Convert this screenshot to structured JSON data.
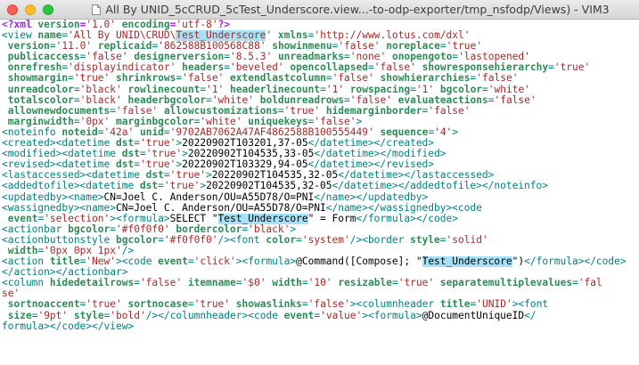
{
  "window": {
    "title": "All By UNID_5cCRUD_5cTest_Underscore.view...-to-odp-exporter/tmp_nsfodp/Views) - VIM3"
  },
  "colors": {
    "tag": "#008080",
    "attribute": "#2e8b57",
    "string": "#a52a2a",
    "processing_instruction": "#a020f0",
    "search_highlight": "#a6e2f7"
  },
  "icons": {
    "document": "document-icon"
  },
  "editor": {
    "lines": [
      [
        [
          "pi",
          "<?xml "
        ],
        [
          "attr",
          "version"
        ],
        [
          "pi",
          "="
        ],
        [
          "str",
          "'1.0'"
        ],
        [
          "pi",
          " "
        ],
        [
          "attr",
          "encoding"
        ],
        [
          "pi",
          "="
        ],
        [
          "str",
          "'utf-8'"
        ],
        [
          "pi",
          "?>"
        ]
      ],
      [
        [
          "tag",
          "<view "
        ],
        [
          "attr",
          "name"
        ],
        [
          "tag",
          "="
        ],
        [
          "str",
          "'All By UNID\\CRUD\\"
        ],
        [
          "hl",
          "Test_Underscore"
        ],
        [
          "str",
          "'"
        ],
        [
          "tag",
          " "
        ],
        [
          "attr",
          "xmlns"
        ],
        [
          "tag",
          "="
        ],
        [
          "str",
          "'http://www.lotus.com/dxl'"
        ]
      ],
      [
        [
          "tag",
          " "
        ],
        [
          "attr",
          "version"
        ],
        [
          "tag",
          "="
        ],
        [
          "str",
          "'11.0'"
        ],
        [
          "tag",
          " "
        ],
        [
          "attr",
          "replicaid"
        ],
        [
          "tag",
          "="
        ],
        [
          "str",
          "'862588B100568C88'"
        ],
        [
          "tag",
          " "
        ],
        [
          "attr",
          "showinmenu"
        ],
        [
          "tag",
          "="
        ],
        [
          "str",
          "'false'"
        ],
        [
          "tag",
          " "
        ],
        [
          "attr",
          "noreplace"
        ],
        [
          "tag",
          "="
        ],
        [
          "str",
          "'true'"
        ]
      ],
      [
        [
          "tag",
          " "
        ],
        [
          "attr",
          "publicaccess"
        ],
        [
          "tag",
          "="
        ],
        [
          "str",
          "'false'"
        ],
        [
          "tag",
          " "
        ],
        [
          "attr",
          "designerversion"
        ],
        [
          "tag",
          "="
        ],
        [
          "str",
          "'8.5.3'"
        ],
        [
          "tag",
          " "
        ],
        [
          "attr",
          "unreadmarks"
        ],
        [
          "tag",
          "="
        ],
        [
          "str",
          "'none'"
        ],
        [
          "tag",
          " "
        ],
        [
          "attr",
          "onopengoto"
        ],
        [
          "tag",
          "="
        ],
        [
          "str",
          "'lastopened'"
        ]
      ],
      [
        [
          "tag",
          " "
        ],
        [
          "attr",
          "onrefresh"
        ],
        [
          "tag",
          "="
        ],
        [
          "str",
          "'displayindicator'"
        ],
        [
          "tag",
          " "
        ],
        [
          "attr",
          "headers"
        ],
        [
          "tag",
          "="
        ],
        [
          "str",
          "'beveled'"
        ],
        [
          "tag",
          " "
        ],
        [
          "attr",
          "opencollapsed"
        ],
        [
          "tag",
          "="
        ],
        [
          "str",
          "'false'"
        ],
        [
          "tag",
          " "
        ],
        [
          "attr",
          "showresponsehierarchy"
        ],
        [
          "tag",
          "="
        ],
        [
          "str",
          "'true'"
        ]
      ],
      [
        [
          "tag",
          " "
        ],
        [
          "attr",
          "showmargin"
        ],
        [
          "tag",
          "="
        ],
        [
          "str",
          "'true'"
        ],
        [
          "tag",
          " "
        ],
        [
          "attr",
          "shrinkrows"
        ],
        [
          "tag",
          "="
        ],
        [
          "str",
          "'false'"
        ],
        [
          "tag",
          " "
        ],
        [
          "attr",
          "extendlastcolumn"
        ],
        [
          "tag",
          "="
        ],
        [
          "str",
          "'false'"
        ],
        [
          "tag",
          " "
        ],
        [
          "attr",
          "showhierarchies"
        ],
        [
          "tag",
          "="
        ],
        [
          "str",
          "'false'"
        ]
      ],
      [
        [
          "tag",
          " "
        ],
        [
          "attr",
          "unreadcolor"
        ],
        [
          "tag",
          "="
        ],
        [
          "str",
          "'black'"
        ],
        [
          "tag",
          " "
        ],
        [
          "attr",
          "rowlinecount"
        ],
        [
          "tag",
          "="
        ],
        [
          "str",
          "'1'"
        ],
        [
          "tag",
          " "
        ],
        [
          "attr",
          "headerlinecount"
        ],
        [
          "tag",
          "="
        ],
        [
          "str",
          "'1'"
        ],
        [
          "tag",
          " "
        ],
        [
          "attr",
          "rowspacing"
        ],
        [
          "tag",
          "="
        ],
        [
          "str",
          "'1'"
        ],
        [
          "tag",
          " "
        ],
        [
          "attr",
          "bgcolor"
        ],
        [
          "tag",
          "="
        ],
        [
          "str",
          "'white'"
        ]
      ],
      [
        [
          "tag",
          " "
        ],
        [
          "attr",
          "totalscolor"
        ],
        [
          "tag",
          "="
        ],
        [
          "str",
          "'black'"
        ],
        [
          "tag",
          " "
        ],
        [
          "attr",
          "headerbgcolor"
        ],
        [
          "tag",
          "="
        ],
        [
          "str",
          "'white'"
        ],
        [
          "tag",
          " "
        ],
        [
          "attr",
          "boldunreadrows"
        ],
        [
          "tag",
          "="
        ],
        [
          "str",
          "'false'"
        ],
        [
          "tag",
          " "
        ],
        [
          "attr",
          "evaluateactions"
        ],
        [
          "tag",
          "="
        ],
        [
          "str",
          "'false'"
        ]
      ],
      [
        [
          "tag",
          " "
        ],
        [
          "attr",
          "allownewdocuments"
        ],
        [
          "tag",
          "="
        ],
        [
          "str",
          "'false'"
        ],
        [
          "tag",
          " "
        ],
        [
          "attr",
          "allowcustomizations"
        ],
        [
          "tag",
          "="
        ],
        [
          "str",
          "'true'"
        ],
        [
          "tag",
          " "
        ],
        [
          "attr",
          "hidemarginborder"
        ],
        [
          "tag",
          "="
        ],
        [
          "str",
          "'false'"
        ]
      ],
      [
        [
          "tag",
          " "
        ],
        [
          "attr",
          "marginwidth"
        ],
        [
          "tag",
          "="
        ],
        [
          "str",
          "'0px'"
        ],
        [
          "tag",
          " "
        ],
        [
          "attr",
          "marginbgcolor"
        ],
        [
          "tag",
          "="
        ],
        [
          "str",
          "'white'"
        ],
        [
          "tag",
          " "
        ],
        [
          "attr",
          "uniquekeys"
        ],
        [
          "tag",
          "="
        ],
        [
          "str",
          "'false'"
        ],
        [
          "tag",
          ">"
        ]
      ],
      [
        [
          "tag",
          "<noteinfo "
        ],
        [
          "attr",
          "noteid"
        ],
        [
          "tag",
          "="
        ],
        [
          "str",
          "'42a'"
        ],
        [
          "tag",
          " "
        ],
        [
          "attr",
          "unid"
        ],
        [
          "tag",
          "="
        ],
        [
          "str",
          "'9702AB7062A47AF4862588B100555449'"
        ],
        [
          "tag",
          " "
        ],
        [
          "attr",
          "sequence"
        ],
        [
          "tag",
          "="
        ],
        [
          "str",
          "'4'"
        ],
        [
          "tag",
          ">"
        ]
      ],
      [
        [
          "tag",
          "<created><datetime "
        ],
        [
          "attr",
          "dst"
        ],
        [
          "tag",
          "="
        ],
        [
          "str",
          "'true'"
        ],
        [
          "tag",
          ">"
        ],
        [
          "txt",
          "20220902T103201,37-05"
        ],
        [
          "tag",
          "</datetime></created>"
        ]
      ],
      [
        [
          "tag",
          "<modified><datetime "
        ],
        [
          "attr",
          "dst"
        ],
        [
          "tag",
          "="
        ],
        [
          "str",
          "'true'"
        ],
        [
          "tag",
          ">"
        ],
        [
          "txt",
          "20220902T104535,33-05"
        ],
        [
          "tag",
          "</datetime></modified>"
        ]
      ],
      [
        [
          "tag",
          "<revised><datetime "
        ],
        [
          "attr",
          "dst"
        ],
        [
          "tag",
          "="
        ],
        [
          "str",
          "'true'"
        ],
        [
          "tag",
          ">"
        ],
        [
          "txt",
          "20220902T103329,94-05"
        ],
        [
          "tag",
          "</datetime></revised>"
        ]
      ],
      [
        [
          "tag",
          "<lastaccessed><datetime "
        ],
        [
          "attr",
          "dst"
        ],
        [
          "tag",
          "="
        ],
        [
          "str",
          "'true'"
        ],
        [
          "tag",
          ">"
        ],
        [
          "txt",
          "20220902T104535,32-05"
        ],
        [
          "tag",
          "</datetime></lastaccessed>"
        ]
      ],
      [
        [
          "tag",
          "<addedtofile><datetime "
        ],
        [
          "attr",
          "dst"
        ],
        [
          "tag",
          "="
        ],
        [
          "str",
          "'true'"
        ],
        [
          "tag",
          ">"
        ],
        [
          "txt",
          "20220902T104535,32-05"
        ],
        [
          "tag",
          "</datetime></addedtofile></noteinfo>"
        ]
      ],
      [
        [
          "tag",
          "<updatedby><name>"
        ],
        [
          "txt",
          "CN=Joel C. Anderson/OU=A55D78/O=PNI"
        ],
        [
          "tag",
          "</name></updatedby>"
        ]
      ],
      [
        [
          "tag",
          "<wassignedby><name>"
        ],
        [
          "txt",
          "CN=Joel C. Anderson/OU=A55D78/O=PNI"
        ],
        [
          "tag",
          "</name></wassignedby><code"
        ]
      ],
      [
        [
          "tag",
          " "
        ],
        [
          "attr",
          "event"
        ],
        [
          "tag",
          "="
        ],
        [
          "str",
          "'selection'"
        ],
        [
          "tag",
          "><formula>"
        ],
        [
          "txt",
          "SELECT \""
        ],
        [
          "hlt",
          "Test_Underscore"
        ],
        [
          "txt",
          "\" = Form"
        ],
        [
          "tag",
          "</formula></code>"
        ]
      ],
      [
        [
          "tag",
          "<actionbar "
        ],
        [
          "attr",
          "bgcolor"
        ],
        [
          "tag",
          "="
        ],
        [
          "str",
          "'#f0f0f0'"
        ],
        [
          "tag",
          " "
        ],
        [
          "attr",
          "bordercolor"
        ],
        [
          "tag",
          "="
        ],
        [
          "str",
          "'black'"
        ],
        [
          "tag",
          ">"
        ]
      ],
      [
        [
          "tag",
          "<actionbuttonstyle "
        ],
        [
          "attr",
          "bgcolor"
        ],
        [
          "tag",
          "="
        ],
        [
          "str",
          "'#f0f0f0'"
        ],
        [
          "tag",
          "/><font "
        ],
        [
          "attr",
          "color"
        ],
        [
          "tag",
          "="
        ],
        [
          "str",
          "'system'"
        ],
        [
          "tag",
          "/><border "
        ],
        [
          "attr",
          "style"
        ],
        [
          "tag",
          "="
        ],
        [
          "str",
          "'solid'"
        ]
      ],
      [
        [
          "tag",
          " "
        ],
        [
          "attr",
          "width"
        ],
        [
          "tag",
          "="
        ],
        [
          "str",
          "'0px 0px 1px'"
        ],
        [
          "tag",
          "/>"
        ]
      ],
      [
        [
          "tag",
          "<action "
        ],
        [
          "attr",
          "title"
        ],
        [
          "tag",
          "="
        ],
        [
          "str",
          "'New'"
        ],
        [
          "tag",
          "><code "
        ],
        [
          "attr",
          "event"
        ],
        [
          "tag",
          "="
        ],
        [
          "str",
          "'click'"
        ],
        [
          "tag",
          "><formula>"
        ],
        [
          "txt",
          "@Command([Compose]; \""
        ],
        [
          "hlt",
          "Test_Underscore"
        ],
        [
          "txt",
          "\")"
        ],
        [
          "tag",
          "</formula></code>"
        ]
      ],
      [
        [
          "tag",
          "</action></actionbar>"
        ]
      ],
      [
        [
          "tag",
          "<column "
        ],
        [
          "attr",
          "hidedetailrows"
        ],
        [
          "tag",
          "="
        ],
        [
          "str",
          "'false'"
        ],
        [
          "tag",
          " "
        ],
        [
          "attr",
          "itemname"
        ],
        [
          "tag",
          "="
        ],
        [
          "str",
          "'$0'"
        ],
        [
          "tag",
          " "
        ],
        [
          "attr",
          "width"
        ],
        [
          "tag",
          "="
        ],
        [
          "str",
          "'10'"
        ],
        [
          "tag",
          " "
        ],
        [
          "attr",
          "resizable"
        ],
        [
          "tag",
          "="
        ],
        [
          "str",
          "'true'"
        ],
        [
          "tag",
          " "
        ],
        [
          "attr",
          "separatemultiplevalues"
        ],
        [
          "tag",
          "="
        ],
        [
          "str",
          "'fal"
        ]
      ],
      [
        [
          "str",
          "se'"
        ]
      ],
      [
        [
          "tag",
          " "
        ],
        [
          "attr",
          "sortnoaccent"
        ],
        [
          "tag",
          "="
        ],
        [
          "str",
          "'true'"
        ],
        [
          "tag",
          " "
        ],
        [
          "attr",
          "sortnocase"
        ],
        [
          "tag",
          "="
        ],
        [
          "str",
          "'true'"
        ],
        [
          "tag",
          " "
        ],
        [
          "attr",
          "showaslinks"
        ],
        [
          "tag",
          "="
        ],
        [
          "str",
          "'false'"
        ],
        [
          "tag",
          "><columnheader "
        ],
        [
          "attr",
          "title"
        ],
        [
          "tag",
          "="
        ],
        [
          "str",
          "'UNID'"
        ],
        [
          "tag",
          "><font"
        ]
      ],
      [
        [
          "tag",
          " "
        ],
        [
          "attr",
          "size"
        ],
        [
          "tag",
          "="
        ],
        [
          "str",
          "'9pt'"
        ],
        [
          "tag",
          " "
        ],
        [
          "attr",
          "style"
        ],
        [
          "tag",
          "="
        ],
        [
          "str",
          "'bold'"
        ],
        [
          "tag",
          "/></columnheader><code "
        ],
        [
          "attr",
          "event"
        ],
        [
          "tag",
          "="
        ],
        [
          "str",
          "'value'"
        ],
        [
          "tag",
          "><formula>"
        ],
        [
          "txt",
          "@DocumentUniqueID"
        ],
        [
          "tag",
          "</"
        ]
      ],
      [
        [
          "tag",
          "formula></code></view>"
        ]
      ]
    ]
  }
}
